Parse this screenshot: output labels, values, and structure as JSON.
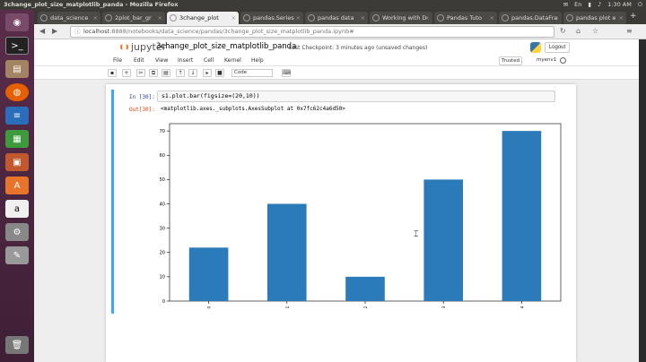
{
  "window_title": "3change_plot_size_matplotlib_panda - Mozilla Firefox",
  "panel": {
    "time": "1:30 AM",
    "lang": "En"
  },
  "tabs": [
    {
      "label": "data_science"
    },
    {
      "label": "2plot_bar_gr"
    },
    {
      "label": "3change_plot"
    },
    {
      "label": "pandas.Series"
    },
    {
      "label": "pandas data"
    },
    {
      "label": "Working with D"
    },
    {
      "label": "Pandas Tuto"
    },
    {
      "label": "pandas.DataFra"
    },
    {
      "label": "pandas plot e"
    }
  ],
  "url": {
    "host": "localhost",
    "rest": ":8888/notebooks/data_science/pandas/3change_plot_size_matplotlib_panda.ipynb#"
  },
  "jupyter": {
    "logo_text": "jupyter",
    "notebook_title": "3change_plot_size_matplotlib_panda",
    "checkpoint": "Last Checkpoint: 3 minutes ago (unsaved changes)",
    "logout_label": "Logout",
    "menu": [
      "File",
      "Edit",
      "View",
      "Insert",
      "Cell",
      "Kernel",
      "Help"
    ],
    "trusted_label": "Trusted",
    "kernel_name": "myenv1",
    "cell_type": "Code"
  },
  "cell": {
    "in_prompt": "In [30]:",
    "code": "s1.plot.bar(figsize=(20,10))",
    "out_prompt": "Out[30]:",
    "output_text": "<matplotlib.axes._subplots.AxesSubplot at 0x7fc62c4a6d50>"
  },
  "chart_data": {
    "type": "bar",
    "categories": [
      "0",
      "1",
      "2",
      "3",
      "4"
    ],
    "values": [
      22,
      40,
      10,
      50,
      70
    ],
    "ylim": [
      0,
      73
    ],
    "yticks": [
      0,
      10,
      20,
      30,
      40,
      50,
      60,
      70
    ],
    "color": "#2b7bba",
    "grid": false
  }
}
